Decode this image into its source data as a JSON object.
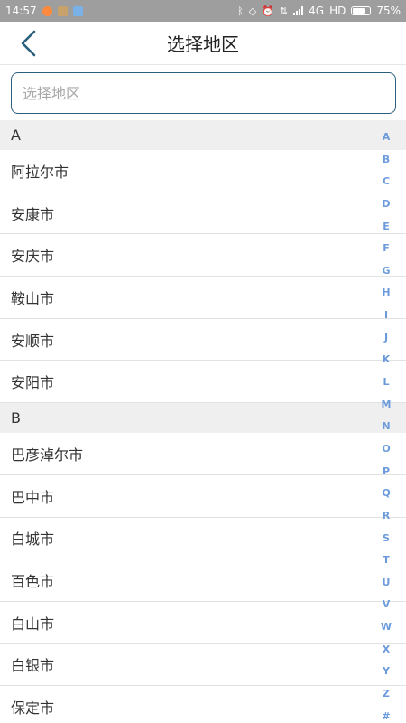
{
  "status_bar": {
    "time": "14:57",
    "network": "4G",
    "hd": "HD",
    "battery_level": "75%",
    "icons": [
      "notification-orange-icon",
      "notification-app-icon",
      "notification-app2-icon",
      "bluetooth-icon",
      "vibrate-icon",
      "alarm-icon",
      "data-icon",
      "signal-icon",
      "battery-icon"
    ],
    "colors": {
      "bar_bg": "#9e9e9e",
      "text": "#ffffff"
    }
  },
  "header": {
    "title": "选择地区",
    "back_icon": "chevron-left-icon",
    "colors": {
      "back_icon": "#2b5f7e"
    }
  },
  "search": {
    "placeholder": "选择地区",
    "value": "",
    "colors": {
      "border": "#2b5f7e"
    }
  },
  "sections": [
    {
      "letter": "A",
      "cities": [
        "阿拉尔市",
        "安康市",
        "安庆市",
        "鞍山市",
        "安顺市",
        "安阳市"
      ]
    },
    {
      "letter": "B",
      "cities": [
        "巴彦淖尔市",
        "巴中市",
        "白城市",
        "百色市",
        "白山市",
        "白银市",
        "保定市"
      ]
    }
  ],
  "index_bar": {
    "letters": [
      "A",
      "B",
      "C",
      "D",
      "E",
      "F",
      "G",
      "H",
      "I",
      "J",
      "K",
      "L",
      "M",
      "N",
      "O",
      "P",
      "Q",
      "R",
      "S",
      "T",
      "U",
      "V",
      "W",
      "X",
      "Y",
      "Z",
      "#"
    ],
    "colors": {
      "letter": "#6c9bdc"
    }
  }
}
